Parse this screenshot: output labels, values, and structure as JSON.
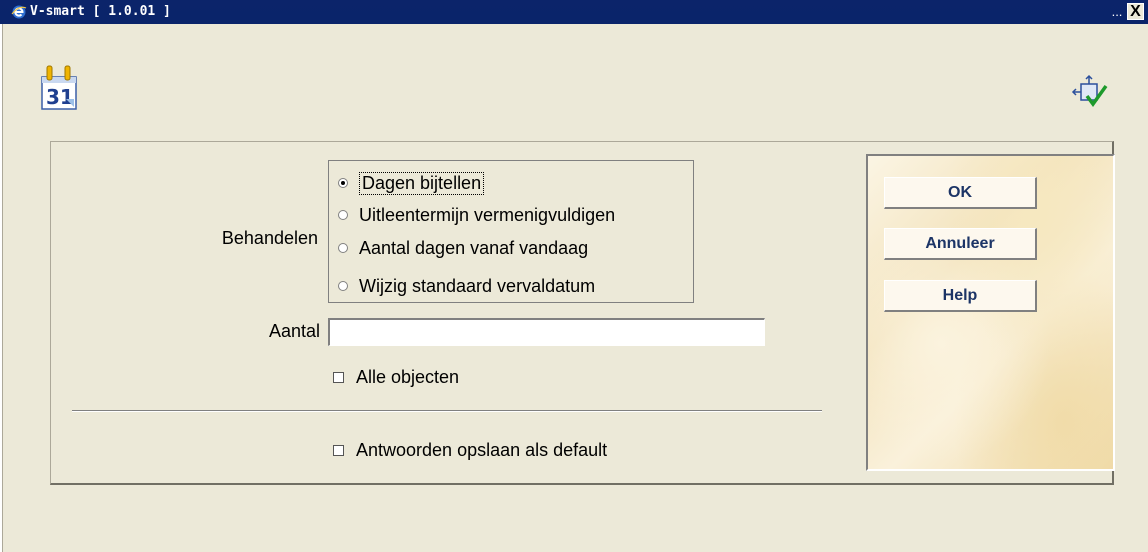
{
  "window": {
    "title": "V-smart [ 1.0.01 ]",
    "minimize_label": "...",
    "close_label": "X"
  },
  "icons": {
    "app": "ie-e-icon",
    "calendar": "calendar-31-icon",
    "tool": "accept-tool-icon"
  },
  "calendar_icon_text": "31",
  "form": {
    "behandelen_label": "Behandelen",
    "options": [
      {
        "label": "Dagen bijtellen",
        "selected": true
      },
      {
        "label": "Uitleentermijn vermenigvuldigen",
        "selected": false
      },
      {
        "label": "Aantal dagen vanaf vandaag",
        "selected": false
      },
      {
        "label": "Wijzig standaard vervaldatum",
        "selected": false
      }
    ],
    "aantal_label": "Aantal",
    "aantal_value": "",
    "alle_objecten_label": "Alle objecten",
    "alle_objecten_checked": false,
    "save_default_label": "Antwoorden opslaan als default",
    "save_default_checked": false
  },
  "buttons": {
    "ok": "OK",
    "cancel": "Annuleer",
    "help": "Help"
  },
  "colors": {
    "titlebar": "#0a246a",
    "window_bg": "#ece9d8",
    "button_text": "#1c3466"
  }
}
